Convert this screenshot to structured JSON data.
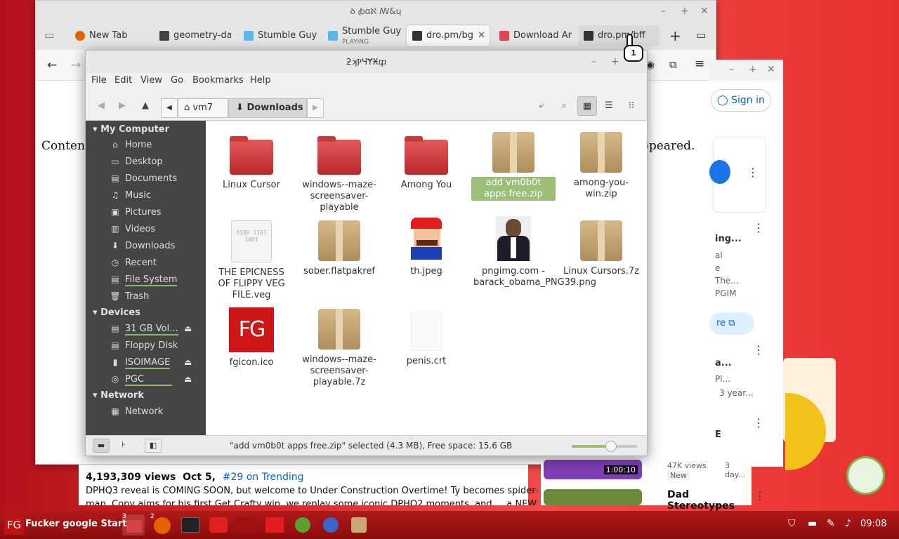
{
  "browser": {
    "title": "ꝺ ꞗɑℵ ꟿ&ɥ",
    "tabs": [
      {
        "label": "New Tab",
        "icon": "firefox-icon"
      },
      {
        "label": "geometry-da",
        "icon": "page-icon"
      },
      {
        "label": "Stumble Guy",
        "icon": "stumble-icon"
      },
      {
        "label": "Stumble Guy",
        "sub": "PLAYING",
        "icon": "stumble-icon"
      },
      {
        "label": "dro.pm/bg",
        "icon": "terminal-icon"
      },
      {
        "label": "Download Ar",
        "icon": "download-icon"
      },
      {
        "label": "dro.pm/bff",
        "icon": "terminal-icon"
      }
    ],
    "content_left": "Content",
    "content_right": "ppeared.",
    "cursor_badge": "1"
  },
  "youtube": {
    "sign_in": "Sign in",
    "side_text_1": "ing...",
    "side_text_2": "al",
    "side_text_3": "e",
    "side_text_4": "The...",
    "side_text_5": "PGIM",
    "side_text_6": "re",
    "side_text_7": "a...",
    "side_text_8": "Pl...",
    "side_text_9": "3 year...",
    "views_line": "4,193,309 views",
    "date": "Oct 5,",
    "trending": "#29 on Trending",
    "description": "DPHQ3 reveal is COMING SOON, but welcome to Under Construction Overtime! Ty becomes spider-",
    "description2": "man. Copy aims for his first Get Crafty win, we replay some iconic DPHQ2 moments, and ... a NEW",
    "thumb_duration": "1:00:10",
    "badge_new": "New",
    "side_views": "47K views",
    "side_days": "3 day...",
    "next_title": "Dad Stereotypes",
    "side_e": "E"
  },
  "filemanager": {
    "title": "ƻʞⲢЧɎӾⴔ",
    "menu": [
      "File",
      "Edit",
      "View",
      "Go",
      "Bookmarks",
      "Help"
    ],
    "breadcrumb": {
      "home": "vm7",
      "current": "Downloads"
    },
    "sidebar": {
      "my_computer": "My Computer",
      "places": [
        {
          "label": "Home",
          "icon": "home-icon"
        },
        {
          "label": "Desktop",
          "icon": "desktop-icon"
        },
        {
          "label": "Documents",
          "icon": "documents-icon"
        },
        {
          "label": "Music",
          "icon": "music-icon"
        },
        {
          "label": "Pictures",
          "icon": "pictures-icon"
        },
        {
          "label": "Videos",
          "icon": "videos-icon"
        },
        {
          "label": "Downloads",
          "icon": "downloads-icon"
        },
        {
          "label": "Recent",
          "icon": "recent-icon"
        },
        {
          "label": "File System",
          "icon": "filesystem-icon"
        },
        {
          "label": "Trash",
          "icon": "trash-icon"
        }
      ],
      "devices_head": "Devices",
      "devices": [
        {
          "label": "31 GB Vol...",
          "icon": "drive-icon"
        },
        {
          "label": "Floppy Disk",
          "icon": "floppy-icon"
        },
        {
          "label": "ISOIMAGE",
          "icon": "usb-icon"
        },
        {
          "label": "PGC",
          "icon": "disc-icon"
        }
      ],
      "network_head": "Network",
      "network": [
        {
          "label": "Network",
          "icon": "network-icon"
        }
      ]
    },
    "files": [
      {
        "name": "Linux Cursor",
        "type": "folder"
      },
      {
        "name": "windows--maze-screensaver-playable",
        "type": "folder"
      },
      {
        "name": "Among You",
        "type": "folder"
      },
      {
        "name": "add vm0b0t apps free.zip",
        "type": "archive",
        "selected": true
      },
      {
        "name": "among-you-win.zip",
        "type": "archive"
      },
      {
        "name": "THE EPICNESS OF FLIPPY VEG FILE.veg",
        "type": "binary"
      },
      {
        "name": "sober.flatpakref",
        "type": "archive"
      },
      {
        "name": "th.jpeg",
        "type": "mario"
      },
      {
        "name": "pngimg.com - barack_obama_PNG39.png",
        "type": "photo"
      },
      {
        "name": "Linux Cursors.7z",
        "type": "archive"
      },
      {
        "name": "fgicon.ico",
        "type": "fg"
      },
      {
        "name": "windows--maze-screensaver-playable.7z",
        "type": "archive"
      },
      {
        "name": "penis.crt",
        "type": "blank"
      }
    ],
    "binary_glyph": "0100 1101 1001",
    "fg_text": "FG",
    "status": "\"add vm0b0t apps free.zip\" selected (4.3 MB), Free space: 15.6 GB",
    "zoom_level": 0.6
  },
  "taskbar": {
    "start_logo": "FG",
    "start_label": "Fucker google Start",
    "badge_files": "3",
    "badge_firefox": "2",
    "clock": "09:08"
  }
}
